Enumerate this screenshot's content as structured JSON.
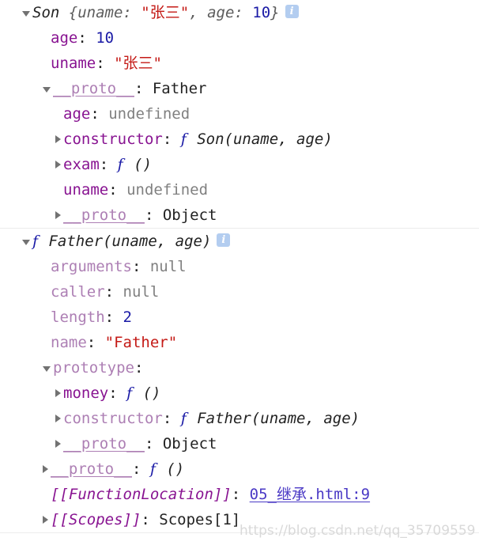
{
  "console": {
    "groups": [
      {
        "name": "son-object-group",
        "rows": [
          {
            "indent": 0,
            "marker": "open",
            "tokens": [
              {
                "cls": "objname",
                "text": "Son"
              },
              {
                "cls": "plain",
                "text": " "
              },
              {
                "cls": "preview",
                "text": "{uname: "
              },
              {
                "cls": "str",
                "text": "\"张三\""
              },
              {
                "cls": "preview",
                "text": ", age: "
              },
              {
                "cls": "num",
                "text": "10"
              },
              {
                "cls": "preview",
                "text": "}"
              }
            ],
            "info": true
          },
          {
            "indent": 1,
            "marker": "none",
            "tokens": [
              {
                "cls": "prop",
                "text": "age"
              },
              {
                "cls": "colon",
                "text": ": "
              },
              {
                "cls": "num",
                "text": "10"
              }
            ]
          },
          {
            "indent": 1,
            "marker": "none",
            "tokens": [
              {
                "cls": "prop",
                "text": "uname"
              },
              {
                "cls": "colon",
                "text": ": "
              },
              {
                "cls": "str",
                "text": "\"张三\""
              }
            ]
          },
          {
            "indent": 1,
            "marker": "open",
            "tokens": [
              {
                "cls": "proto-link",
                "text": "__proto__"
              },
              {
                "cls": "colon",
                "text": ": "
              },
              {
                "cls": "plain",
                "text": "Father"
              }
            ]
          },
          {
            "indent": 2,
            "marker": "none",
            "tokens": [
              {
                "cls": "prop",
                "text": "age"
              },
              {
                "cls": "colon",
                "text": ": "
              },
              {
                "cls": "undef",
                "text": "undefined"
              }
            ]
          },
          {
            "indent": 2,
            "marker": "closed",
            "tokens": [
              {
                "cls": "prop",
                "text": "constructor"
              },
              {
                "cls": "colon",
                "text": ": "
              },
              {
                "cls": "fn-f",
                "text": "f"
              },
              {
                "cls": "fn-sig",
                "text": " Son(uname, age)"
              }
            ]
          },
          {
            "indent": 2,
            "marker": "closed",
            "tokens": [
              {
                "cls": "prop",
                "text": "exam"
              },
              {
                "cls": "colon",
                "text": ": "
              },
              {
                "cls": "fn-f",
                "text": "f"
              },
              {
                "cls": "fn-sig",
                "text": " ()"
              }
            ]
          },
          {
            "indent": 2,
            "marker": "none",
            "tokens": [
              {
                "cls": "prop",
                "text": "uname"
              },
              {
                "cls": "colon",
                "text": ": "
              },
              {
                "cls": "undef",
                "text": "undefined"
              }
            ]
          },
          {
            "indent": 2,
            "marker": "closed",
            "tokens": [
              {
                "cls": "proto-link",
                "text": "__proto__"
              },
              {
                "cls": "colon",
                "text": ": "
              },
              {
                "cls": "plain",
                "text": "Object"
              }
            ]
          }
        ]
      },
      {
        "name": "father-function-group",
        "rows": [
          {
            "indent": 0,
            "marker": "open",
            "tokens": [
              {
                "cls": "fn-f",
                "text": "f"
              },
              {
                "cls": "fn-sig",
                "text": " Father(uname, age)"
              }
            ],
            "info": true
          },
          {
            "indent": 1,
            "marker": "none",
            "tokens": [
              {
                "cls": "prop-dim",
                "text": "arguments"
              },
              {
                "cls": "colon",
                "text": ": "
              },
              {
                "cls": "nul",
                "text": "null"
              }
            ]
          },
          {
            "indent": 1,
            "marker": "none",
            "tokens": [
              {
                "cls": "prop-dim",
                "text": "caller"
              },
              {
                "cls": "colon",
                "text": ": "
              },
              {
                "cls": "nul",
                "text": "null"
              }
            ]
          },
          {
            "indent": 1,
            "marker": "none",
            "tokens": [
              {
                "cls": "prop-dim",
                "text": "length"
              },
              {
                "cls": "colon",
                "text": ": "
              },
              {
                "cls": "num",
                "text": "2"
              }
            ]
          },
          {
            "indent": 1,
            "marker": "none",
            "tokens": [
              {
                "cls": "prop-dim",
                "text": "name"
              },
              {
                "cls": "colon",
                "text": ": "
              },
              {
                "cls": "str",
                "text": "\"Father\""
              }
            ]
          },
          {
            "indent": 1,
            "marker": "open",
            "tokens": [
              {
                "cls": "prop-dim",
                "text": "prototype"
              },
              {
                "cls": "colon",
                "text": ":"
              }
            ]
          },
          {
            "indent": 2,
            "marker": "closed",
            "tokens": [
              {
                "cls": "prop",
                "text": "money"
              },
              {
                "cls": "colon",
                "text": ": "
              },
              {
                "cls": "fn-f",
                "text": "f"
              },
              {
                "cls": "fn-sig",
                "text": " ()"
              }
            ]
          },
          {
            "indent": 2,
            "marker": "closed",
            "tokens": [
              {
                "cls": "prop-dim",
                "text": "constructor"
              },
              {
                "cls": "colon",
                "text": ": "
              },
              {
                "cls": "fn-f",
                "text": "f"
              },
              {
                "cls": "fn-sig",
                "text": " Father(uname, age)"
              }
            ]
          },
          {
            "indent": 2,
            "marker": "closed",
            "tokens": [
              {
                "cls": "proto-link",
                "text": "__proto__"
              },
              {
                "cls": "colon",
                "text": ": "
              },
              {
                "cls": "plain",
                "text": "Object"
              }
            ]
          },
          {
            "indent": 1,
            "marker": "closed",
            "tokens": [
              {
                "cls": "proto-link",
                "text": "__proto__"
              },
              {
                "cls": "colon",
                "text": ": "
              },
              {
                "cls": "fn-f",
                "text": "f"
              },
              {
                "cls": "fn-sig",
                "text": " ()"
              }
            ]
          },
          {
            "indent": 1,
            "marker": "none",
            "tokens": [
              {
                "cls": "internal",
                "text": "[[FunctionLocation]]"
              },
              {
                "cls": "colon",
                "text": ": "
              },
              {
                "cls": "srclink",
                "text": "05_继承.html:9"
              }
            ]
          },
          {
            "indent": 1,
            "marker": "closed",
            "tokens": [
              {
                "cls": "internal",
                "text": "[[Scopes]]"
              },
              {
                "cls": "colon",
                "text": ": "
              },
              {
                "cls": "plain",
                "text": "Scopes[1]"
              }
            ]
          }
        ]
      }
    ]
  },
  "info_icon_glyph": "i",
  "watermark": "https://blog.csdn.net/qq_35709559",
  "colors": {
    "property": "#881391",
    "property_non_enumerable": "#ad7fb4",
    "number": "#1a1aa6",
    "string": "#c41a16",
    "undefined": "#808080",
    "link": "#4a39c5",
    "info_badge": "#b3cdf0",
    "divider": "#ececec"
  }
}
